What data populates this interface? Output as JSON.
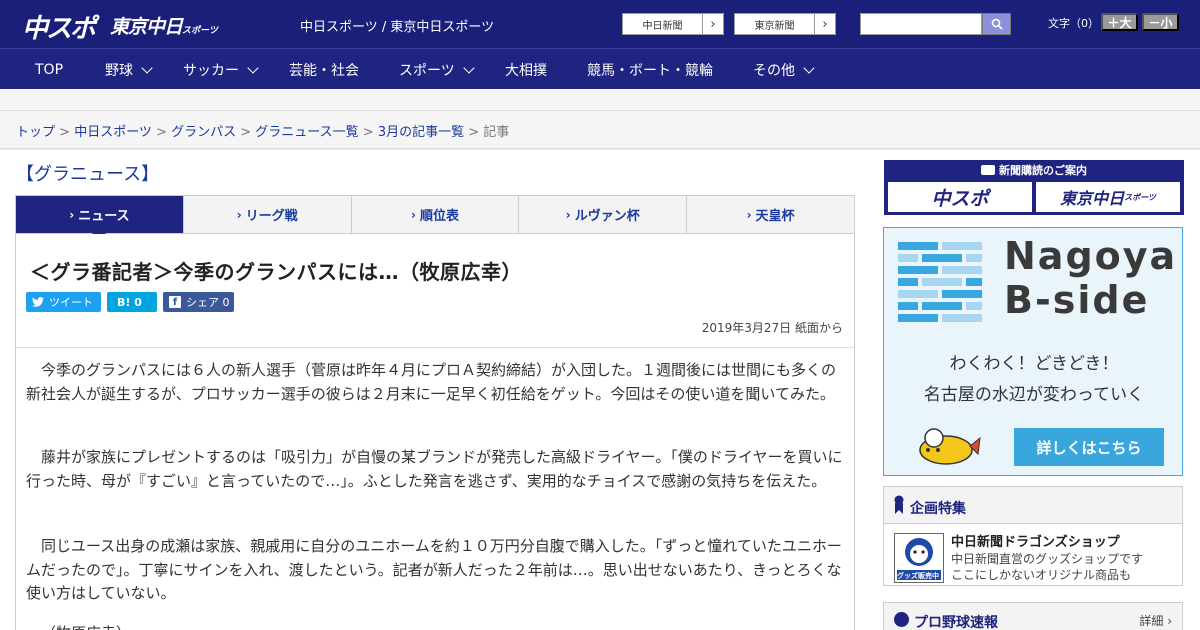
{
  "header": {
    "logo_chuspo": "中スポ",
    "logo_tokyo": "東京中日",
    "logo_tokyo_small": "スポーツ",
    "site_names": "中日スポーツ / 東京中日スポーツ",
    "btn_chunichi": "中日新聞",
    "btn_tokyo": "東京新聞",
    "fontsize_label": "文字（0）",
    "font_plus": "＋大",
    "font_minus": "－小"
  },
  "nav": {
    "items": [
      {
        "label": "TOP"
      },
      {
        "label": "野球"
      },
      {
        "label": "サッカー"
      },
      {
        "label": "芸能・社会"
      },
      {
        "label": "スポーツ"
      },
      {
        "label": "大相撲"
      },
      {
        "label": "競馬・ボート・競輪"
      },
      {
        "label": "その他"
      }
    ]
  },
  "breadcrumb": {
    "items": [
      "トップ",
      "中日スポーツ",
      "グランパス",
      "グラニュース一覧",
      "3月の記事一覧"
    ],
    "current": "記事",
    "sep": " > "
  },
  "section_title": "【グラニュース】",
  "tabs": [
    {
      "label": "ニュース"
    },
    {
      "label": "リーグ戦"
    },
    {
      "label": "順位表"
    },
    {
      "label": "ルヴァン杯"
    },
    {
      "label": "天皇杯"
    }
  ],
  "article": {
    "headline": "＜グラ番記者＞今季のグランパスには…（牧原広幸）",
    "share_tweet": "ツイート",
    "share_hatena": "B! 0",
    "share_fb": "シェア 0",
    "date": "2019年3月27日 紙面から",
    "paragraphs": [
      "今季のグランパスには６人の新人選手（菅原は昨年４月にプロＡ契約締結）が入団した。１週間後には世間にも多くの新社会人が誕生するが、プロサッカー選手の彼らは２月末に一足早く初任給をゲット。今回はその使い道を聞いてみた。",
      "藤井が家族にプレゼントするのは「吸引力」が自慢の某ブランドが発売した高級ドライヤー。「僕のドライヤーを買いに行った時、母が『すごい』と言っていたので…」。ふとした発言を逃さず、実用的なチョイスで感謝の気持ちを伝えた。",
      "同じユース出身の成瀬は家族、親戚用に自分のユニホームを約１０万円分自腹で購入した。「ずっと憧れていたユニホームだったので」。丁寧にサインを入れ、渡したという。記者が新人だった２年前は…。思い出せないあたり、きっとろくな使い方はしていない。",
      "（牧原広幸）"
    ]
  },
  "sidebar": {
    "promo_title": "新聞購読のご案内",
    "promo_chuspo": "中スポ",
    "promo_tokyo": "東京中日",
    "promo_tokyo_small": "スポーツ",
    "banner_title_1": "Nagoya",
    "banner_title_2": "B-side",
    "banner_sub_1": "わくわく！どきどき！",
    "banner_sub_2": "名古屋の水辺が変わっていく",
    "banner_btn": "詳しくはこちら",
    "feature_head": "企画特集",
    "shop_title": "中日新聞ドラゴンズショップ",
    "shop_desc_1": "中日新聞直営のグッズショップです",
    "shop_desc_2": "ここにしかないオリジナル商品も",
    "shop_badge": "グッズ販売中",
    "pro_title": "プロ野球速報",
    "pro_detail": "詳細 ›"
  },
  "colors": {
    "header_bg": "#1a1f7a",
    "nav_bg": "#1f2480",
    "link": "#1a3aa0",
    "twitter": "#1da1f2",
    "hatena": "#00a4de",
    "facebook": "#3b5998",
    "banner_accent": "#3aa6de"
  }
}
